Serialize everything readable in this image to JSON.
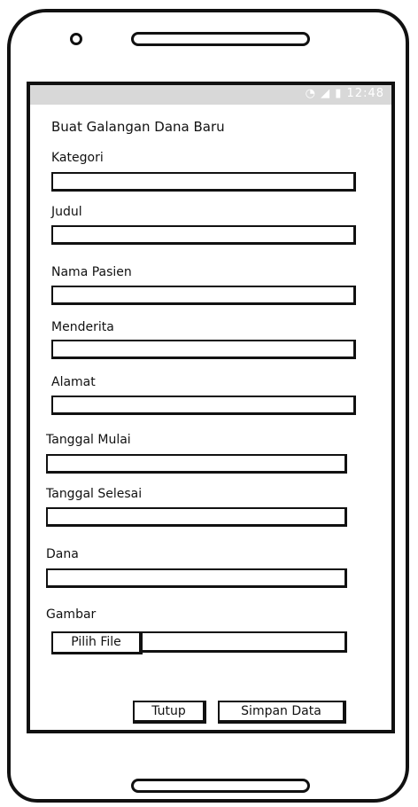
{
  "status": {
    "icons": "wifi-icon signal-icon battery-icon",
    "time": "12:48"
  },
  "form": {
    "title": "Buat Galangan Dana Baru",
    "fields": {
      "kategori": "Kategori",
      "judul": "Judul",
      "nama_pasien": "Nama Pasien",
      "menderita": "Menderita",
      "alamat": "Alamat",
      "tanggal_mulai": "Tanggal Mulai",
      "tanggal_selesai": "Tanggal Selesai",
      "dana": "Dana",
      "gambar": "Gambar"
    },
    "file_button": "Pilih File"
  },
  "actions": {
    "close": "Tutup",
    "save": "Simpan Data"
  }
}
